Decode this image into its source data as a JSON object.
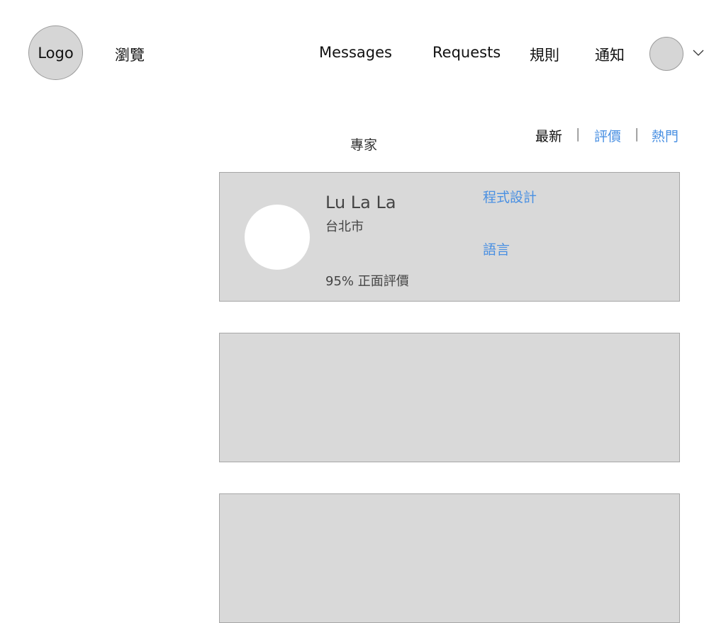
{
  "header": {
    "logo_text": "Logo",
    "browse_label": "瀏覽",
    "nav": [
      "Messages",
      "Requests",
      "規則",
      "通知"
    ],
    "chevron_icon": "chevron-down-icon"
  },
  "main": {
    "section_title": "專家",
    "sort": {
      "active": "最新",
      "options": [
        "評價",
        "熱門"
      ],
      "separator": "|"
    },
    "cards": [
      {
        "name": "Lu La La",
        "city": "台北市",
        "rating": "95% 正面評價",
        "skills": [
          "程式設計",
          "語言"
        ]
      }
    ]
  },
  "colors": {
    "link": "#4a90e2",
    "card_bg": "#d9d9d9",
    "placeholder_gray": "#d6d6d6"
  }
}
